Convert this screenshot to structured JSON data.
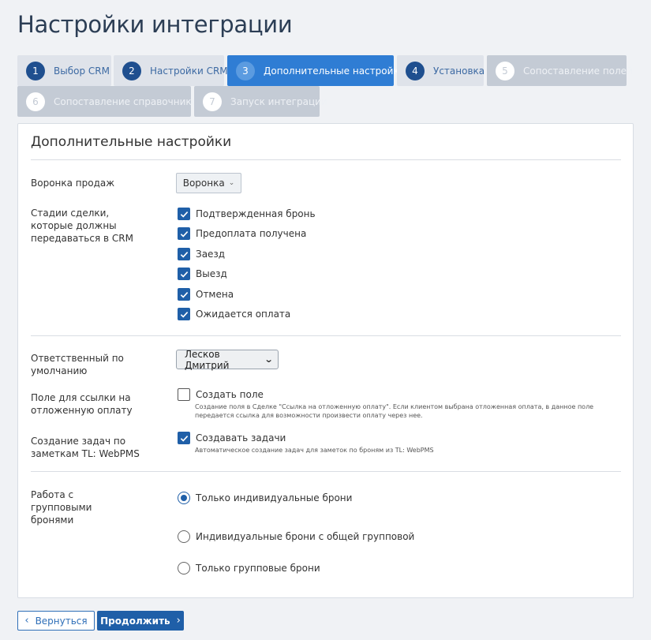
{
  "page": {
    "title": "Настройки интеграции"
  },
  "steps": [
    {
      "num": "1",
      "label": "Выбор CRM",
      "state": "done"
    },
    {
      "num": "2",
      "label": "Настройки CRM",
      "state": "done"
    },
    {
      "num": "3",
      "label": "Дополнительные настройки",
      "state": "active"
    },
    {
      "num": "4",
      "label": "Установка",
      "state": "upcoming"
    },
    {
      "num": "5",
      "label": "Сопоставление полей",
      "state": "disabled"
    },
    {
      "num": "6",
      "label": "Сопоставление справочников",
      "state": "disabled"
    },
    {
      "num": "7",
      "label": "Запуск интеграции",
      "state": "disabled"
    }
  ],
  "panel": {
    "title": "Дополнительные настройки",
    "funnel": {
      "label": "Воронка продаж",
      "value": "Воронка",
      "icon": "chevron-down-icon"
    },
    "stages": {
      "label": "Стадии сделки, которые должны передаваться в CRM",
      "items": [
        {
          "label": "Подтвержденная бронь",
          "checked": true
        },
        {
          "label": "Предоплата получена",
          "checked": true
        },
        {
          "label": "Заезд",
          "checked": true
        },
        {
          "label": "Выезд",
          "checked": true
        },
        {
          "label": "Отмена",
          "checked": true
        },
        {
          "label": "Ожидается оплата",
          "checked": true
        }
      ]
    },
    "responsible": {
      "label": "Ответственный по умолчанию",
      "value": "Лесков Дмитрий"
    },
    "deferred_link": {
      "label": "Поле для ссылки на отложенную оплату",
      "checkbox_label": "Создать поле",
      "checked": false,
      "help": "Создание поля в Сделке \"Ссылка на отложенную оплату\". Если клиентом выбрана отложенная оплата, в данное поле передается ссылка для возможности произвести оплату через нее."
    },
    "tasks": {
      "label": "Создание задач по заметкам TL: WebPMS",
      "checkbox_label": "Создавать задачи",
      "checked": true,
      "help": "Автоматическое создание задач для заметок по броням из TL: WebPMS"
    },
    "group_bookings": {
      "label": "Работа с групповыми бронями",
      "options": [
        {
          "label": "Только индивидуальные брони",
          "selected": true
        },
        {
          "label": "Индивидуальные брони с общей групповой",
          "selected": false
        },
        {
          "label": "Только групповые брони",
          "selected": false
        }
      ]
    }
  },
  "footer": {
    "back_label": "Вернуться",
    "next_label": "Продолжить"
  },
  "colors": {
    "primary": "#1f5fa8",
    "active_step": "#2f7dd4",
    "page_bg": "#f0f2f5"
  }
}
